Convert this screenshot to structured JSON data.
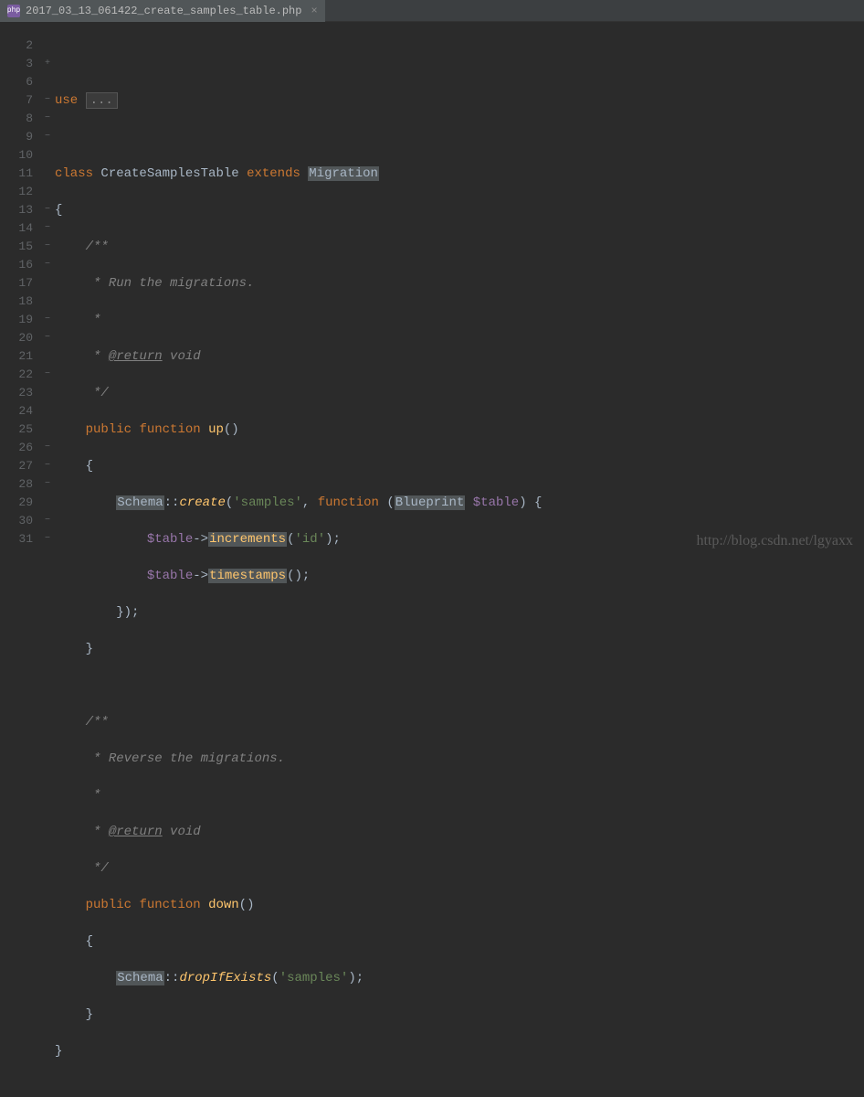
{
  "tab": {
    "filename": "2017_03_13_061422_create_samples_table.php",
    "icon_text": "php"
  },
  "watermark": "http://blog.csdn.net/lgyaxx",
  "lines": {
    "start": 2,
    "end": 31
  },
  "code": {
    "l3_use": "use",
    "l3_fold": "...",
    "l7_class": "class",
    "l7_name": "CreateSamplesTable",
    "l7_extends": "extends",
    "l7_parent": "Migration",
    "l8": "{",
    "l9": "/**",
    "l10": " * Run the migrations.",
    "l11": " *",
    "l12_star": " * ",
    "l12_tag": "@return",
    "l12_rest": " void",
    "l13": " */",
    "l14_public": "public",
    "l14_function": "function",
    "l14_name": "up",
    "l14_paren": "()",
    "l15": "{",
    "l16_schema": "Schema",
    "l16_dcolon": "::",
    "l16_create": "create",
    "l16_p1": "(",
    "l16_str": "'samples'",
    "l16_comma": ", ",
    "l16_func": "function",
    "l16_sp": " (",
    "l16_blueprint": "Blueprint",
    "l16_sp2": " ",
    "l16_table": "$table",
    "l16_end": ") {",
    "l17_table": "$table",
    "l17_arrow": "->",
    "l17_method": "increments",
    "l17_p": "(",
    "l17_str": "'id'",
    "l17_end": ");",
    "l18_table": "$table",
    "l18_arrow": "->",
    "l18_method": "timestamps",
    "l18_end": "();",
    "l19": "});",
    "l20": "}",
    "l22": "/**",
    "l23": " * Reverse the migrations.",
    "l24": " *",
    "l25_star": " * ",
    "l25_tag": "@return",
    "l25_rest": " void",
    "l26": " */",
    "l27_public": "public",
    "l27_function": "function",
    "l27_name": "down",
    "l27_paren": "()",
    "l28": "{",
    "l29_schema": "Schema",
    "l29_dcolon": "::",
    "l29_method": "dropIfExists",
    "l29_p": "(",
    "l29_str": "'samples'",
    "l29_end": ");",
    "l30": "}",
    "l31": "}"
  }
}
